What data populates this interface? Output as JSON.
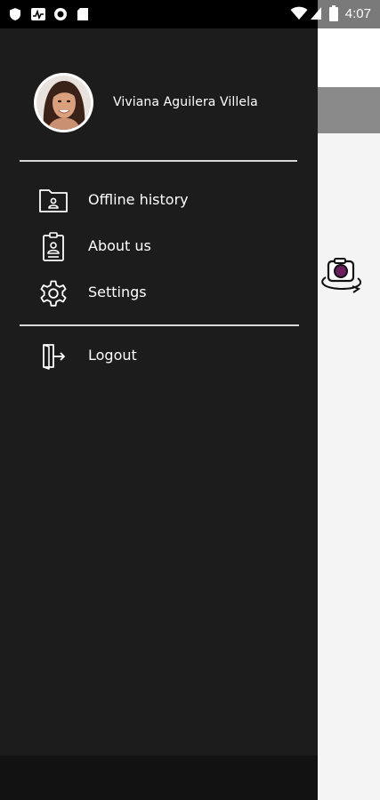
{
  "status_bar": {
    "time": "4:07",
    "left_icons": [
      "shield-icon",
      "activity-icon",
      "record-icon",
      "sd-card-icon"
    ],
    "right_icons": [
      "wifi-icon",
      "signal-icon",
      "battery-icon"
    ]
  },
  "drawer": {
    "user": {
      "name": "Viviana Aguilera Villela",
      "avatar": "user-avatar"
    },
    "menu": [
      {
        "id": "offline-history",
        "label": "Offline history",
        "icon": "folder-user-icon"
      },
      {
        "id": "about-us",
        "label": "About us",
        "icon": "id-badge-icon"
      },
      {
        "id": "settings",
        "label": "Settings",
        "icon": "gear-icon"
      }
    ],
    "secondary_menu": [
      {
        "id": "logout",
        "label": "Logout",
        "icon": "logout-door-icon"
      }
    ]
  },
  "background": {
    "camera_button": "switch-camera-icon",
    "accent_color": "#6b1f5e"
  },
  "colors": {
    "drawer_bg": "#1c1c1c",
    "text": "#ffffff",
    "divider": "#d8d8d8",
    "toolbar_gray": "#8a8a8a"
  }
}
